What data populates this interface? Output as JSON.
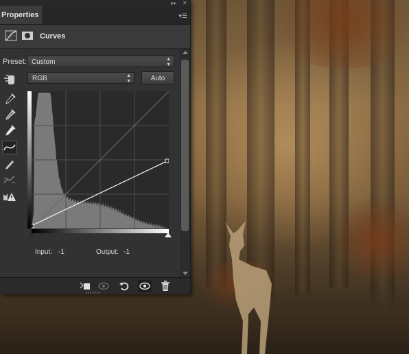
{
  "panel": {
    "tab_title": "Properties",
    "adjustment_title": "Curves",
    "preset_label": "Preset:",
    "preset_value": "Custom",
    "channel_value": "RGB",
    "auto_label": "Auto",
    "input_label": "Input:",
    "input_value": "-1",
    "output_label": "Output:",
    "output_value": "-1"
  },
  "icons": {
    "collapse": "double-chevron-right-icon",
    "close": "close-icon",
    "menu": "panel-menu-icon",
    "curves_adjustment": "curves-adjustment-icon",
    "mask": "layer-mask-icon",
    "targeted_adjustment": "hand-adjust-icon",
    "black_point": "black-eyedropper-icon",
    "gray_point": "gray-eyedropper-icon",
    "white_point": "white-eyedropper-icon",
    "edit_points": "curve-points-icon",
    "draw_pencil": "pencil-icon",
    "smooth": "smooth-curve-icon",
    "clipping": "clipping-warning-icon",
    "clip_to_layer": "clip-to-layer-icon",
    "view_previous": "view-previous-state-icon",
    "reset": "reset-icon",
    "visibility": "eye-icon",
    "delete": "trash-icon"
  },
  "colors": {
    "panel_bg": "#323232",
    "histogram": "#7a7a7a",
    "curve_line": "#e8e8e8"
  }
}
